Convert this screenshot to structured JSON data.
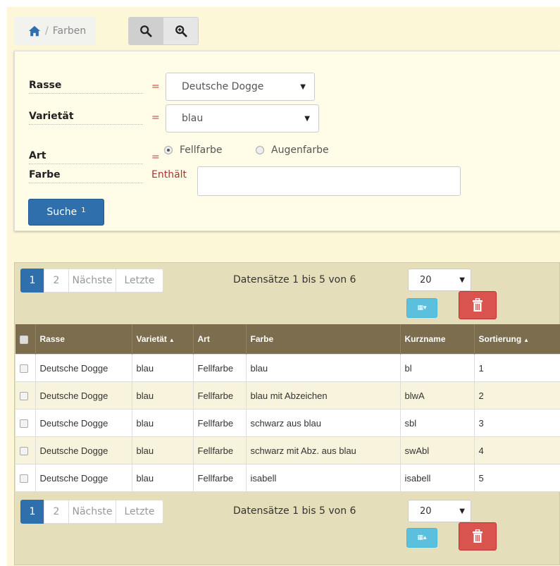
{
  "breadcrumb": {
    "home_icon": "home-icon",
    "current": "Farben"
  },
  "toolbar": {
    "search_icon": "search-icon",
    "zoom_icon": "zoom-in-icon"
  },
  "filters": {
    "rasse": {
      "label": "Rasse",
      "operator": "=",
      "value": "Deutsche Dogge"
    },
    "varietaet": {
      "label": "Varietät",
      "operator": "=",
      "value": "blau"
    },
    "art": {
      "label": "Art",
      "operator": "=",
      "options": [
        "Fellfarbe",
        "Augenfarbe"
      ],
      "selected": "Fellfarbe"
    },
    "farbe": {
      "label": "Farbe",
      "operator": "Enthält",
      "value": ""
    },
    "submit": {
      "label": "Suche",
      "badge": "1"
    }
  },
  "pagination": {
    "pages": [
      "1",
      "2"
    ],
    "active_page": "1",
    "next_label": "Nächste",
    "last_label": "Letzte",
    "records_info": "Datensätze 1 bis 5 von 6",
    "page_size": "20"
  },
  "table": {
    "columns": [
      "Rasse",
      "Varietät",
      "Art",
      "Farbe",
      "Kurzname",
      "Sortierung"
    ],
    "rows": [
      [
        "Deutsche Dogge",
        "blau",
        "Fellfarbe",
        "blau",
        "bl",
        "1"
      ],
      [
        "Deutsche Dogge",
        "blau",
        "Fellfarbe",
        "blau mit Abzeichen",
        "blwA",
        "2"
      ],
      [
        "Deutsche Dogge",
        "blau",
        "Fellfarbe",
        "schwarz aus blau",
        "sbl",
        "3"
      ],
      [
        "Deutsche Dogge",
        "blau",
        "Fellfarbe",
        "schwarz mit Abz. aus blau",
        "swAbl",
        "4"
      ],
      [
        "Deutsche Dogge",
        "blau",
        "Fellfarbe",
        "isabell",
        "isabell",
        "5"
      ]
    ]
  },
  "colors": {
    "primary": "#2f6fab",
    "header_bg": "#7c6d4f",
    "danger": "#d9534f",
    "info": "#5bc0de",
    "panel_bg": "#fcf7d6"
  }
}
